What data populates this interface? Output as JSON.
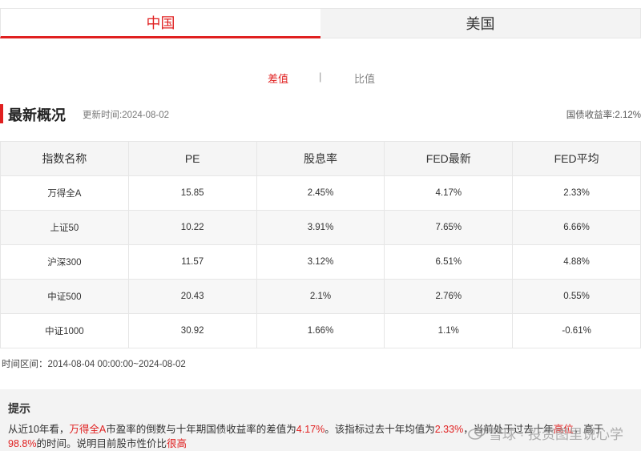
{
  "tabs": [
    {
      "label": "中国",
      "active": true
    },
    {
      "label": "美国",
      "active": false
    }
  ],
  "segment": {
    "diff": "差值",
    "separator": "|",
    "ratio": "比值"
  },
  "section": {
    "title": "最新概况",
    "updated": "更新时间:2024-08-02",
    "bond_yield": "国债收益率:2.12%"
  },
  "table": {
    "headers": [
      "指数名称",
      "PE",
      "股息率",
      "FED最新",
      "FED平均"
    ],
    "rows": [
      [
        "万得全A",
        "15.85",
        "2.45%",
        "4.17%",
        "2.33%"
      ],
      [
        "上证50",
        "10.22",
        "3.91%",
        "7.65%",
        "6.66%"
      ],
      [
        "沪深300",
        "11.57",
        "3.12%",
        "6.51%",
        "4.88%"
      ],
      [
        "中证500",
        "20.43",
        "2.1%",
        "2.76%",
        "0.55%"
      ],
      [
        "中证1000",
        "30.92",
        "1.66%",
        "1.1%",
        "-0.61%"
      ]
    ]
  },
  "range": "时间区间：2014-08-04 00:00:00~2024-08-02",
  "tip": {
    "title": "提示",
    "l1_a": "从近10年看，",
    "l1_index": "万得全A",
    "l1_b": "市盈率的倒数与十年期国债收益率的差值为",
    "l1_val": "4.17%",
    "l1_c": "。该指标过去十年均值为",
    "l1_avg": "2.33%",
    "l1_d": "，当前处于过去十年",
    "l1_level": "高位",
    "l1_e": "，高于",
    "l2_pct": "98.8%",
    "l2_a": "的时间。说明目前股市性价比",
    "l2_judge": "很高"
  },
  "watermark": "雪球 · 投资图里说心学",
  "colors": {
    "accent": "#e02020",
    "header_bg": "#f5f5f5",
    "tip_bg": "#f3f3f3"
  }
}
